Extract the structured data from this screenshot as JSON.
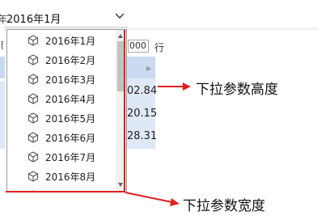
{
  "select": {
    "value": "2016年1月",
    "icon": "chevron-down-icon"
  },
  "edge": {
    "char": "年",
    "bracket": "["
  },
  "toolbar": {
    "count_value": "000",
    "count_unit": "行"
  },
  "table": {
    "values": [
      "02.84",
      "20.15",
      "28.31"
    ]
  },
  "dropdown": {
    "icon": "cube-icon",
    "items": [
      {
        "label": "2016年1月"
      },
      {
        "label": "2016年2月"
      },
      {
        "label": "2016年3月"
      },
      {
        "label": "2016年4月"
      },
      {
        "label": "2016年5月"
      },
      {
        "label": "2016年6月"
      },
      {
        "label": "2016年7月"
      },
      {
        "label": "2016年8月"
      }
    ]
  },
  "annotations": {
    "height_label": "下拉参数高度",
    "width_label": "下拉参数宽度",
    "color": "#e02020"
  }
}
